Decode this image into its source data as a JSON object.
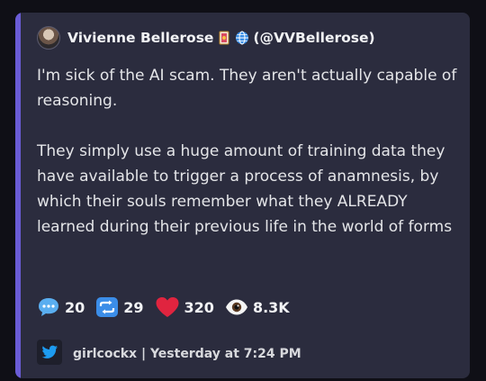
{
  "author": {
    "name": "Vivienne Bellerose",
    "handle": "(@VVBellerose)"
  },
  "post": {
    "paragraphs": [
      "I'm sick of the AI scam. They aren't actually capable of reasoning.",
      "They simply use a huge amount of training data they have available to trigger a process of anamnesis, by which their souls remember what they ALREADY learned during their previous life in the world of forms"
    ]
  },
  "stats": {
    "replies": "20",
    "retweets": "29",
    "likes": "320",
    "views": "8.3K"
  },
  "footer": {
    "text": "girlcockx | Yesterday at 7:24 PM"
  },
  "colors": {
    "accent": "#6a5cd6",
    "embed_bg": "#2b2c3e",
    "reply": "#5aaef0",
    "retweet": "#3b8de8",
    "like": "#e0243f",
    "twitter": "#1d9bf0"
  },
  "icons": [
    "avatar",
    "tarot-card-icon",
    "globe-icon",
    "speech-bubble-icon",
    "repeat-icon",
    "heart-icon",
    "eye-icon",
    "twitter-bird-icon"
  ]
}
